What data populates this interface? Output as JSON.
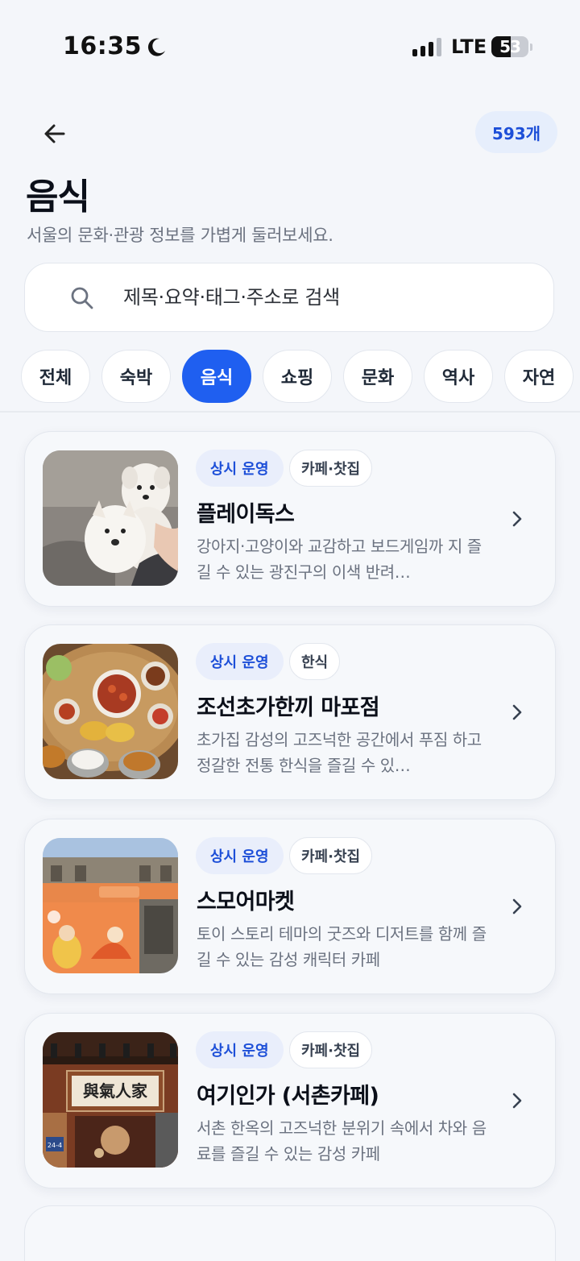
{
  "status_bar": {
    "time": "16:35",
    "network": "LTE",
    "battery": "53",
    "battery_level": 0.53
  },
  "header": {
    "back_icon": "arrow-left-icon",
    "count": "593개",
    "title": "음식",
    "subtitle": "서울의 문화·관광 정보를 가볍게 둘러보세요."
  },
  "search": {
    "placeholder": "제목·요약·태그·주소로 검색",
    "value": "",
    "icon": "search-icon"
  },
  "categories": [
    {
      "label": "전체",
      "active": false
    },
    {
      "label": "숙박",
      "active": false
    },
    {
      "label": "음식",
      "active": true
    },
    {
      "label": "쇼핑",
      "active": false
    },
    {
      "label": "문화",
      "active": false
    },
    {
      "label": "역사",
      "active": false
    },
    {
      "label": "자연",
      "active": false
    }
  ],
  "places": [
    {
      "status": "상시 운영",
      "tag": "카페·찻집",
      "title": "플레이독스",
      "desc": "강아지·고양이와 교감하고 보드게임까 지 즐길 수 있는 광진구의 이색 반려…",
      "thumb": "dogs-photo"
    },
    {
      "status": "상시 운영",
      "tag": "한식",
      "title": "조선초가한끼 마포점",
      "desc": "초가집 감성의 고즈넉한 공간에서 푸짐 하고 정갈한 전통 한식을 즐길 수 있…",
      "thumb": "korean-meal-photo"
    },
    {
      "status": "상시 운영",
      "tag": "카페·찻집",
      "title": "스모어마켓",
      "desc": "토이 스토리 테마의 굿즈와 디저트를 함께 즐길 수 있는 감성 캐릭터 카페",
      "thumb": "store-front-photo"
    },
    {
      "status": "상시 운영",
      "tag": "카페·찻집",
      "title": "여기인가 (서촌카페)",
      "desc": "서촌 한옥의 고즈넉한 분위기 속에서 차와 음료를 즐길 수 있는 감성 카페",
      "thumb": "hanok-cafe-photo",
      "sign_text": "與氣人家",
      "sign_number": "24-4"
    }
  ],
  "colors": {
    "accent": "#1f5ff0",
    "background": "#f4f6fa",
    "tag_blue": "#1d4fd8"
  }
}
